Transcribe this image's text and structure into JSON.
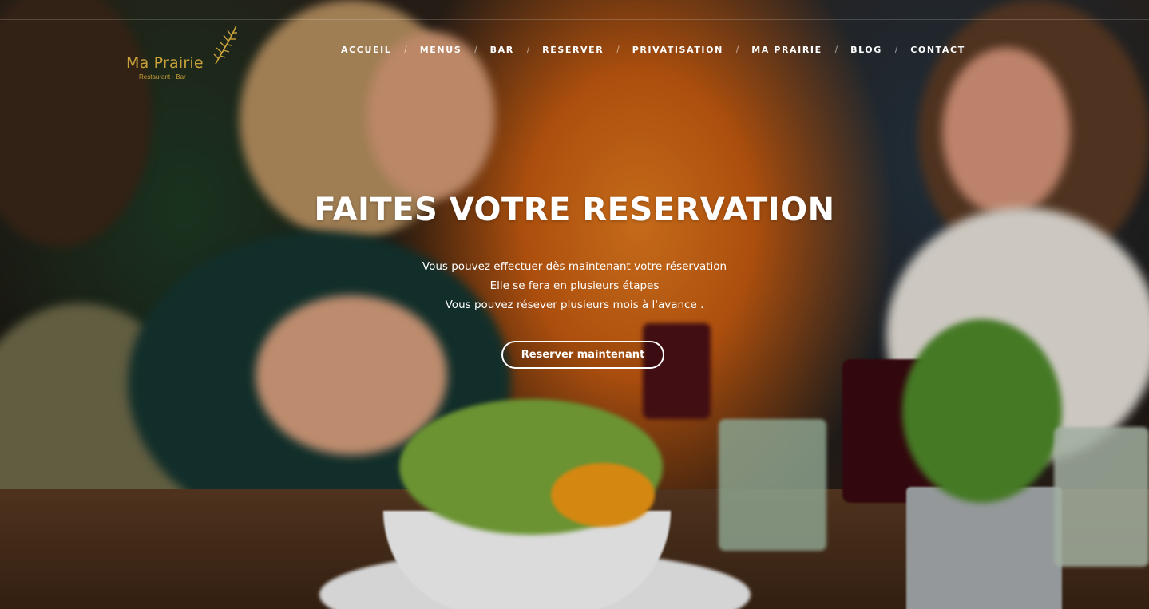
{
  "header": {
    "logo": {
      "name": "Ma Prairie",
      "tagline": "Restaurant - Bar",
      "color": "#c9a23a",
      "icon": "fern-leaf-icon"
    }
  },
  "nav": {
    "items": [
      {
        "label": "ACCUEIL"
      },
      {
        "label": "MENUS"
      },
      {
        "label": "BAR"
      },
      {
        "label": "RÉSERVER"
      },
      {
        "label": "PRIVATISATION"
      },
      {
        "label": "MA PRAIRIE"
      },
      {
        "label": "BLOG"
      },
      {
        "label": "CONTACT"
      }
    ],
    "separator": "/"
  },
  "hero": {
    "title": "FAITES VOTRE RESERVATION",
    "lines": [
      "Vous pouvez effectuer dès maintenant votre réservation",
      "Elle se fera en plusieurs étapes",
      "Vous pouvez résever plusieurs mois à l'avance ."
    ],
    "cta_label": "Reserver maintenant"
  }
}
